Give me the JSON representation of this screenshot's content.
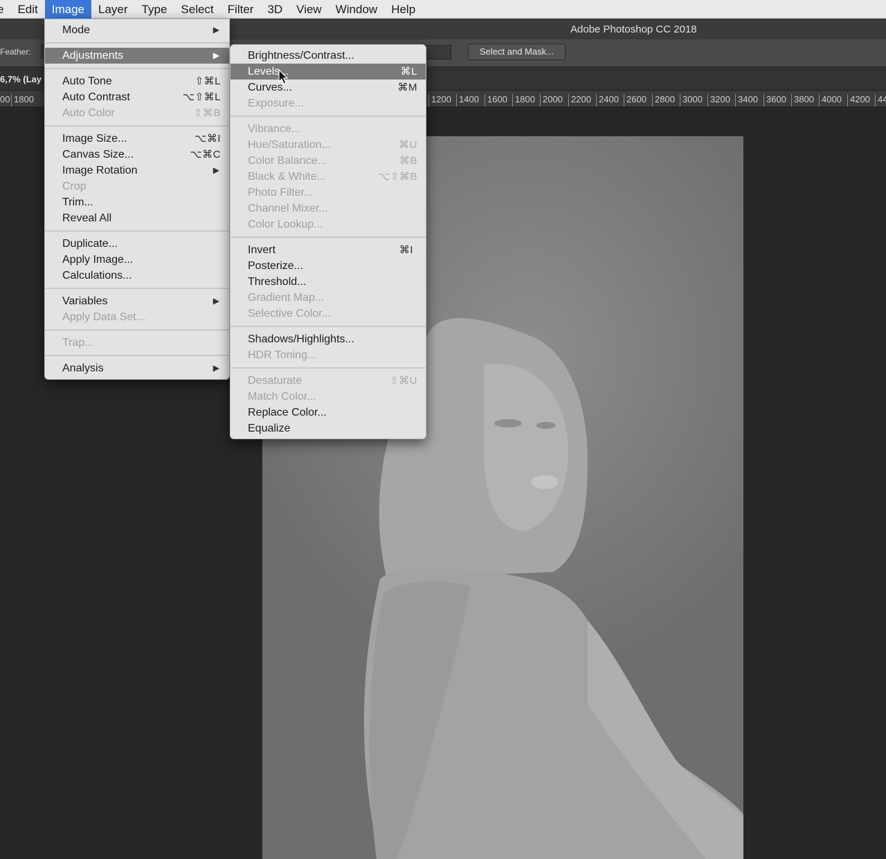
{
  "menubar": {
    "items": [
      "e",
      "Edit",
      "Image",
      "Layer",
      "Type",
      "Select",
      "Filter",
      "3D",
      "View",
      "Window",
      "Help"
    ],
    "active": "Image"
  },
  "app_title": "Adobe Photoshop CC 2018",
  "options_bar": {
    "feather_label": "Feather:",
    "select_and_mask": "Select and Mask..."
  },
  "doc_tab": "6,7% (Lay",
  "ruler": {
    "left_ticks": [
      "00",
      "1800"
    ],
    "right_ticks": [
      "1200",
      "1400",
      "1600",
      "1800",
      "2000",
      "2200",
      "2400",
      "2600",
      "2800",
      "3000",
      "3200",
      "3400",
      "3600",
      "3800",
      "4000",
      "4200",
      "44"
    ]
  },
  "image_menu": {
    "mode": "Mode",
    "adjustments": "Adjustments",
    "auto_tone": "Auto Tone",
    "auto_tone_sc": "⇧⌘L",
    "auto_contrast": "Auto Contrast",
    "auto_contrast_sc": "⌥⇧⌘L",
    "auto_color": "Auto Color",
    "auto_color_sc": "⇧⌘B",
    "image_size": "Image Size...",
    "image_size_sc": "⌥⌘I",
    "canvas_size": "Canvas Size...",
    "canvas_size_sc": "⌥⌘C",
    "image_rotation": "Image Rotation",
    "crop": "Crop",
    "trim": "Trim...",
    "reveal_all": "Reveal All",
    "duplicate": "Duplicate...",
    "apply_image": "Apply Image...",
    "calculations": "Calculations...",
    "variables": "Variables",
    "apply_data_set": "Apply Data Set...",
    "trap": "Trap...",
    "analysis": "Analysis"
  },
  "adjustments_menu": {
    "brightness_contrast": "Brightness/Contrast...",
    "levels": "Levels...",
    "levels_sc": "⌘L",
    "curves": "Curves...",
    "curves_sc": "⌘M",
    "exposure": "Exposure...",
    "vibrance": "Vibrance...",
    "hue_saturation": "Hue/Saturation...",
    "hue_saturation_sc": "⌘U",
    "color_balance": "Color Balance...",
    "color_balance_sc": "⌘B",
    "black_white": "Black & White...",
    "black_white_sc": "⌥⇧⌘B",
    "photo_filter": "Photo Filter...",
    "channel_mixer": "Channel Mixer...",
    "color_lookup": "Color Lookup...",
    "invert": "Invert",
    "invert_sc": "⌘I",
    "posterize": "Posterize...",
    "threshold": "Threshold...",
    "gradient_map": "Gradient Map...",
    "selective_color": "Selective Color...",
    "shadows_highlights": "Shadows/Highlights...",
    "hdr_toning": "HDR Toning...",
    "desaturate": "Desaturate",
    "desaturate_sc": "⇧⌘U",
    "match_color": "Match Color...",
    "replace_color": "Replace Color...",
    "equalize": "Equalize"
  }
}
